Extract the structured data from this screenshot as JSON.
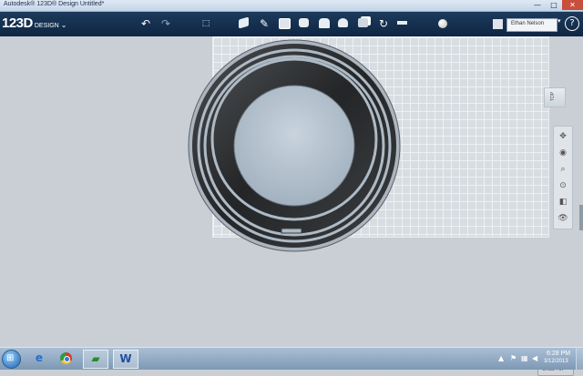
{
  "window": {
    "title": "Autodesk® 123D® Design Untitled*",
    "min_glyph": "—",
    "max_glyph": "□",
    "close_glyph": "✕"
  },
  "app": {
    "logo_main": "123D",
    "logo_sub": "DESIGN",
    "logo_chevron": "⌄"
  },
  "toolbar": {
    "undo_glyph": "↶",
    "redo_glyph": "↷",
    "tools": [
      {
        "name": "transform-icon"
      },
      {
        "name": "primitives-icon"
      },
      {
        "name": "sketch-icon"
      },
      {
        "name": "construct-icon"
      },
      {
        "name": "modify-icon"
      },
      {
        "name": "pattern-icon"
      },
      {
        "name": "grouping-icon"
      },
      {
        "name": "combine-icon"
      },
      {
        "name": "snap-icon"
      },
      {
        "name": "measure-icon"
      }
    ],
    "user_name": "Ethan Nelson",
    "user_caret": "▾",
    "help": "?"
  },
  "viewport": {
    "viewcube_label": "TOP",
    "units_label": "Units : in"
  },
  "colors": {
    "toolbar": "#1c3a5c",
    "canvas": "#c9cfd5",
    "grid": "#d8dde2",
    "part_dark": "#2a2c2e",
    "part_face": "#b6c3cf"
  },
  "taskbar": {
    "start_glyph": "⊞",
    "ie_glyph": "e",
    "word_glyph": "W",
    "clock_time": "6:28 PM",
    "clock_date": "3/12/2013"
  }
}
